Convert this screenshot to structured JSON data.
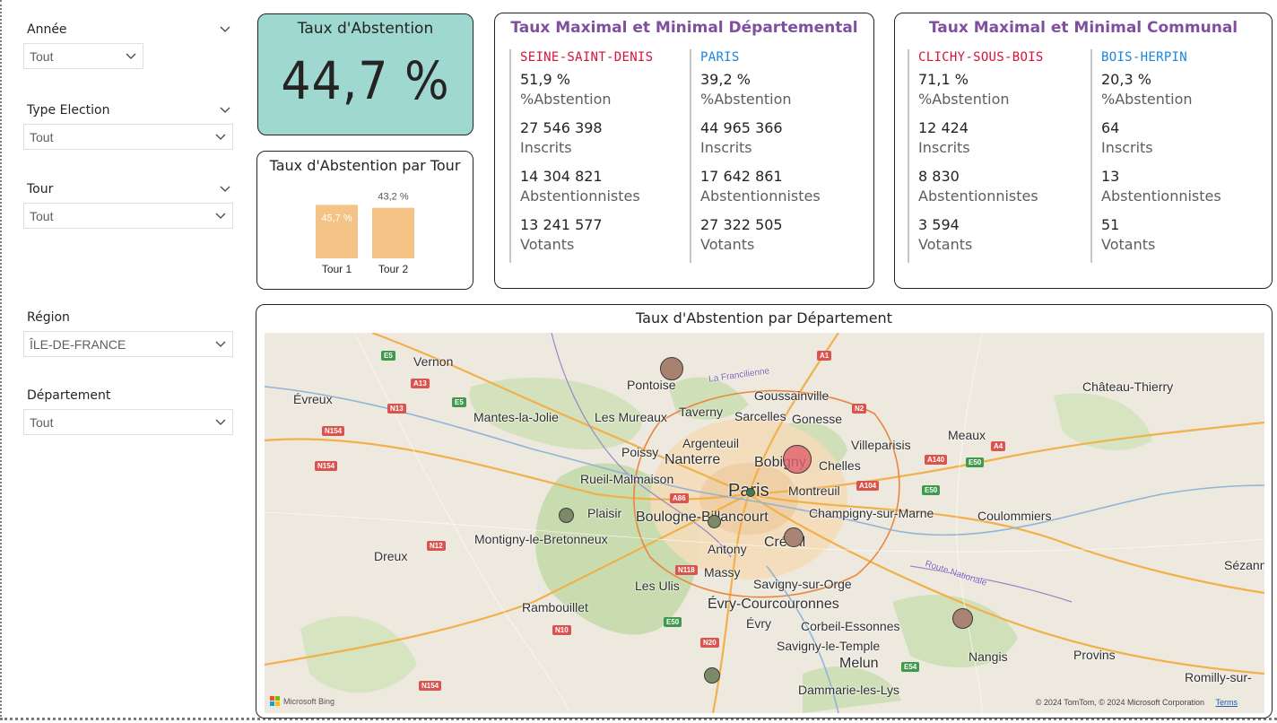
{
  "slicers": {
    "annee": {
      "label": "Année",
      "value": "Tout"
    },
    "type_election": {
      "label": "Type Election",
      "value": "Tout"
    },
    "tour": {
      "label": "Tour",
      "value": "Tout"
    },
    "region": {
      "label": "Région",
      "value": "ÎLE-DE-FRANCE"
    },
    "departement": {
      "label": "Département",
      "value": "Tout"
    }
  },
  "kpi": {
    "title": "Taux d'Abstention",
    "value": "44,7 %"
  },
  "tour_chart": {
    "title": "Taux d'Abstention par Tour",
    "chart_data": {
      "type": "bar",
      "categories": [
        "Tour 1",
        "Tour 2"
      ],
      "values": [
        45.7,
        43.2
      ],
      "data_labels": [
        "45,7 %",
        "43,2 %"
      ],
      "bar_color": "#f3c486",
      "title": "Taux d'Abstention par Tour"
    }
  },
  "dept": {
    "title": "Taux Maximal et Minimal Départemental",
    "max": {
      "name": "SEINE-SAINT-DENIS",
      "pct": "51,9 %",
      "pct_label": "%Abstention",
      "inscrits": "27 546 398",
      "inscrits_label": "Inscrits",
      "abst": "14 304 821",
      "abst_label": "Abstentionnistes",
      "votants": "13 241 577",
      "votants_label": "Votants"
    },
    "min": {
      "name": "PARIS",
      "pct": "39,2 %",
      "pct_label": "%Abstention",
      "inscrits": "44 965 366",
      "inscrits_label": "Inscrits",
      "abst": "17 642 861",
      "abst_label": "Abstentionnistes",
      "votants": "27 322 505",
      "votants_label": "Votants"
    }
  },
  "commune": {
    "title": "Taux Maximal et Minimal Communal",
    "max": {
      "name": "CLICHY-SOUS-BOIS",
      "pct": "71,1 %",
      "pct_label": "%Abstention",
      "inscrits": "12 424",
      "inscrits_label": "Inscrits",
      "abst": "8 830",
      "abst_label": "Abstentionnistes",
      "votants": "3 594",
      "votants_label": "Votants"
    },
    "min": {
      "name": "BOIS-HERPIN",
      "pct": "20,3 %",
      "pct_label": "%Abstention",
      "inscrits": "64",
      "inscrits_label": "Inscrits",
      "abst": "13",
      "abst_label": "Abstentionnistes",
      "votants": "51",
      "votants_label": "Votants"
    }
  },
  "map": {
    "title": "Taux d'Abstention par Département",
    "cities": {
      "vernon": "Vernon",
      "evreux": "Évreux",
      "pontoise": "Pontoise",
      "goussainville": "Goussainville",
      "chateau_thierry": "Château-Thierry",
      "mantes": "Mantes-la-Jolie",
      "mureaux": "Les Mureaux",
      "taverny": "Taverny",
      "sarcelles": "Sarcelles",
      "gonesse": "Gonesse",
      "meaux": "Meaux",
      "argenteuil": "Argenteuil",
      "villeparisis": "Villeparisis",
      "poissy": "Poissy",
      "nanterre": "Nanterre",
      "bobigny": "Bobigny",
      "chelles": "Chelles",
      "rueil": "Rueil-Malmaison",
      "paris": "Paris",
      "montreuil": "Montreuil",
      "plaisir": "Plaisir",
      "boulogne": "Boulogne-Billancourt",
      "champigny": "Champigny-sur-Marne",
      "coulommiers": "Coulommiers",
      "montigny": "Montigny-le-Bretonneux",
      "creteil": "Créteil",
      "antony": "Antony",
      "dreux": "Dreux",
      "massy": "Massy",
      "sezanne": "Sézann",
      "ulis": "Les Ulis",
      "savigny": "Savigny-sur-Orge",
      "rambouillet": "Rambouillet",
      "evry_c": "Évry-Courcouronnes",
      "evry": "Évry",
      "corbeil": "Corbeil-Essonnes",
      "nangis": "Nangis",
      "savigny_temple": "Savigny-le-Temple",
      "provins": "Provins",
      "melun": "Melun",
      "romilly": "Romilly-sur-",
      "dammarie": "Dammarie-les-Lys",
      "francilienne": "La Francilienne",
      "route_nationale": "Route Nationale"
    },
    "roads": {
      "a1": "A1",
      "e5a": "E5",
      "a13": "A13",
      "e5b": "E5",
      "n13": "N13",
      "n154a": "N154",
      "n154b": "N154",
      "n2": "N2",
      "a4": "A4",
      "a140": "A140",
      "e50a": "E50",
      "e50b": "E50",
      "a86": "A86",
      "a104": "A104",
      "n12": "N12",
      "n118": "N118",
      "e50c": "E50",
      "n10": "N10",
      "n20": "N20",
      "e54": "E54",
      "n154c": "N154"
    },
    "bubble_colors": {
      "high": "#d96a72",
      "mid": "#a98373",
      "low": "#7d8a6a",
      "tiny": "#3e7c54"
    },
    "attribution": "© 2024 TomTom, © 2024 Microsoft Corporation",
    "terms": "Terms",
    "bing": "Microsoft Bing"
  }
}
